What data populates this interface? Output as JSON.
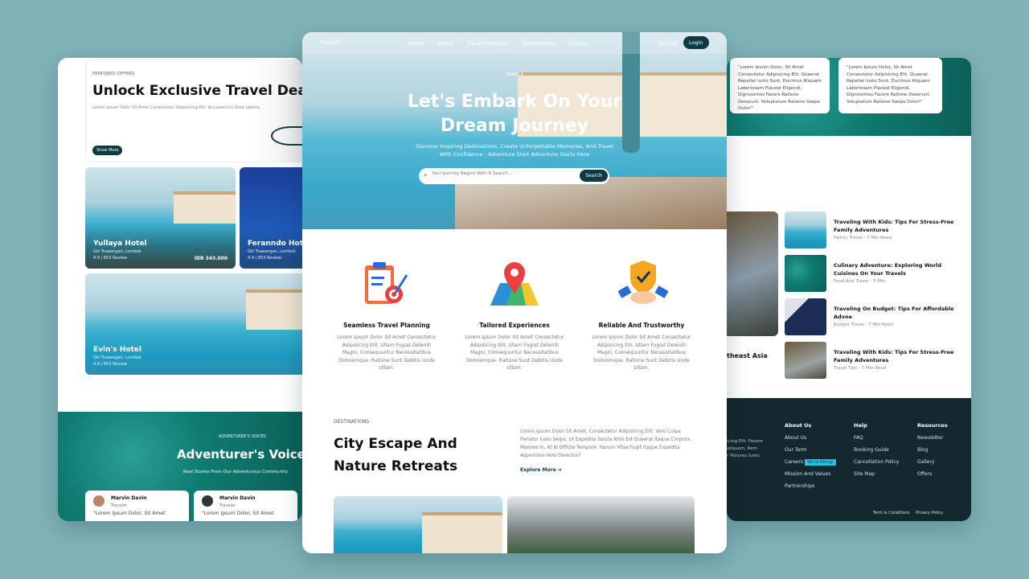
{
  "left": {
    "featured": {
      "eyebrow": "FEATURED OFFERS",
      "title": "Unlock Exclusive Travel Deals",
      "text": "Lorem Ipsum Dolor Sit Amet Consectetur Adipisicing Elit. Accusantium Esse Labore,",
      "button": "Show More"
    },
    "hotels": [
      {
        "name": "Yullaya Hotel",
        "location": "Gili Trawangan, Lombok",
        "rating": "4.9 | 853 Review",
        "price": "IDR 343.000"
      },
      {
        "name": "Feranndo Hotel",
        "location": "Gili Trawangan, Lombok",
        "rating": "4.9 | 853 Review"
      },
      {
        "name": "Evin's Hotel",
        "location": "Gili Trawangan, Lombok",
        "rating": "4.9 | 853 Review"
      }
    ],
    "voices": {
      "eyebrow": "ADVENTURER'S VOICES",
      "title": "Adventurer's Voices",
      "subtitle": "Real Stories From Our Adventurous Community",
      "cards": [
        {
          "name": "Marvin Davin",
          "role": "Traveler",
          "text": "\"Lorem Ipsum Dolor, Sit Amet"
        },
        {
          "name": "Marvin Davin",
          "role": "Traveler",
          "text": "\"Lorem Ipsum Dolor, Sit Amet"
        }
      ]
    }
  },
  "center": {
    "nav": {
      "logo": "TravelX",
      "links": [
        "Home",
        "About",
        "Travel Packages",
        "Destinations",
        "Careers"
      ],
      "signup": "Sign Up",
      "login": "Login"
    },
    "hero": {
      "eyebrow": "TRAVELX",
      "title_line1": "Let's Embark On Your",
      "title_line2": "Dream Journey",
      "subtitle_line1": "Discover Inspiring Destinations, Create Unforgettable Memories, And Travel",
      "subtitle_line2": "With Confidence - Adventure Start Adventure Starts Here",
      "search_placeholder": "Your Journey Begins With A Search...",
      "search_button": "Search"
    },
    "features": [
      {
        "icon": "clipboard-target-icon",
        "title": "Seamless Travel Planning",
        "text": "Lorem Ipsum Dolor Sit Amet Consectetur Adipisicing Elit. Ullam Fugiat Deleniti Magni, Consequuntur Necessitatibus Doloremque. Ratione Sunt Debitis Unde Ullam."
      },
      {
        "icon": "map-pin-icon",
        "title": "Tailored Experiences",
        "text": "Lorem Ipsum Dolor Sit Amet Consectetur Adipisicing Elit. Ullam Fugiat Deleniti Magni, Consequuntur Necessitatibus Doloremque. Ratione Sunt Debitis Unde Ullam."
      },
      {
        "icon": "handshake-shield-icon",
        "title": "Reliable And Trustworthy",
        "text": "Lorem Ipsum Dolor Sit Amet Consectetur Adipisicing Elit. Ullam Fugiat Deleniti Magni, Consequuntur Necessitatibus Doloremque. Ratione Sunt Debitis Unde Ullam."
      }
    ],
    "destinations": {
      "eyebrow": "DESTINATIONS",
      "title_line1": "City Escape And",
      "title_line2": "Nature Retreats",
      "text": "Lorem Ipsum Dolor Sit Amet, Consectetur Adipisicing Elit. Vero Culpa Pariatur Iusto Sequi, Ut Expedita Soluta Nihil Est Quaerat Itaque Corporis Maiores In, At Id Officiis Tempore. Harum Vitae Fugit Itaque Expedita Asperiores Vero Delectus?",
      "link": "Explore More"
    }
  },
  "right": {
    "testimonials": [
      "\"Lorem Ipsum Dolor, Sit Amet Consectetur Adipisicing Elit. Quaerat Repellat Iusto Sunt, Ducimus Aliquam Laboriosam Placeat Eligendi, Dignissimos Facere Ratione Deserunt. Voluptatum Ratione Saepe Dolor!\"",
      "\"Lorem Ipsum Dolor, Sit Amet Consectetur Adipisicing Elit. Quaerat Repellat Iusto Sunt, Ducimus Aliquam Laboriosam Placeat Eligendi, Dignissimos Facere Ratione Deserunt. Voluptatum Ratione Saepe Dolor!\""
    ],
    "featured_caption": "theast Asia",
    "blogs": [
      {
        "title": "Traveling With Kids: Tips For Stress-Free Family Adventures",
        "meta": "Family Travel - 7 Min Read"
      },
      {
        "title": "Culinary Adventure: Exploring World Cuisines On Your Travels",
        "meta": "Food And Travel - 5 Min"
      },
      {
        "title": "Traveling On Budget: Tips For Affordable Advne",
        "meta": "Budget Travel - 7 Min Read"
      },
      {
        "title": "Traveling With Kids: Tips For Stress-Free Family Adventures",
        "meta": "Travel Tips - 7 Min Read"
      }
    ],
    "footer": {
      "about_lines": [
        "icing Elit. Facere",
        "aliquam, Rem",
        "r Maiores Iusto"
      ],
      "about": {
        "title": "About Us",
        "items": [
          "About Us",
          "Our Term",
          "Careers",
          "Mission And Values",
          "Partnerships"
        ],
        "badge": "We're Hiring!"
      },
      "help": {
        "title": "Help",
        "items": [
          "FAQ",
          "Booking Guide",
          "Cancellation Policy",
          "Site Map"
        ]
      },
      "resources": {
        "title": "Resources",
        "items": [
          "Newsletter",
          "Blog",
          "Gallery",
          "Offers"
        ]
      },
      "legal": [
        "Term & Conditions",
        "Privacy Policy"
      ]
    }
  },
  "colors": {
    "primary": "#0e3b43",
    "accent": "#22c3e6",
    "footer": "#14282f",
    "background": "#80b3b8"
  }
}
